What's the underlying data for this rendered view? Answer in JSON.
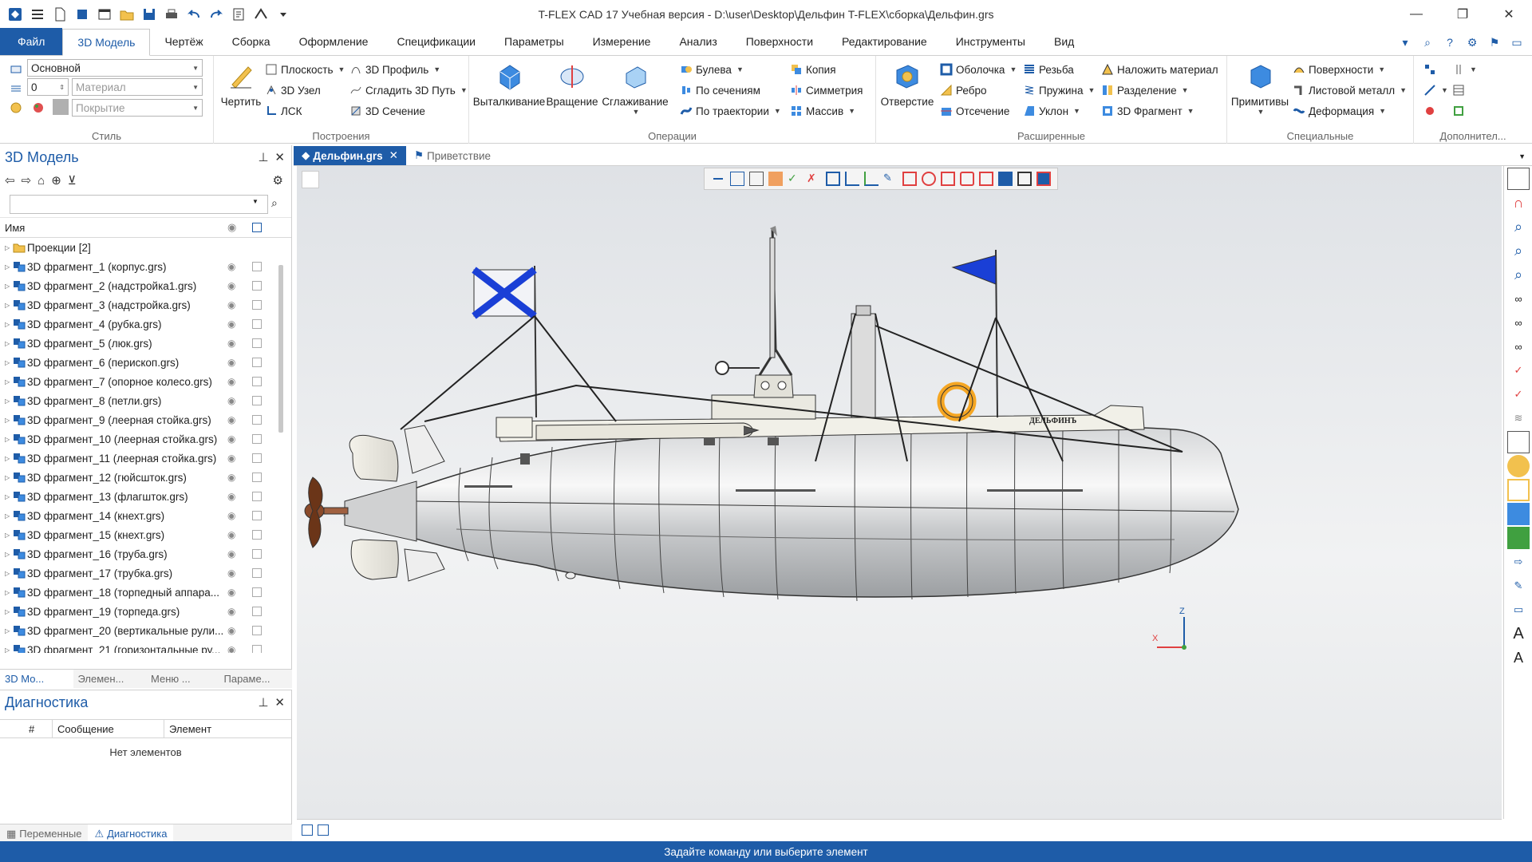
{
  "app": {
    "title": "T-FLEX CAD 17 Учебная версия - D:\\user\\Desktop\\Дельфин T-FLEX\\сборка\\Дельфин.grs"
  },
  "ribbon_tabs": [
    "Файл",
    "3D Модель",
    "Чертёж",
    "Сборка",
    "Оформление",
    "Спецификации",
    "Параметры",
    "Измерение",
    "Анализ",
    "Поверхности",
    "Редактирование",
    "Инструменты",
    "Вид"
  ],
  "active_tab": "3D Модель",
  "style_group": {
    "label": "Стиль",
    "layer": "Основной",
    "level": "0",
    "material_placeholder": "Материал",
    "coating_placeholder": "Покрытие"
  },
  "build_group": {
    "label": "Построения",
    "draw": "Чертить",
    "plane": "Плоскость",
    "node3d": "3D Узел",
    "lsk": "ЛСК",
    "profile3d": "3D Профиль",
    "smooth_path": "Сгладить 3D Путь",
    "section3d": "3D Сечение"
  },
  "ops_group": {
    "label": "Операции",
    "extrude": "Выталкивание",
    "rotate": "Вращение",
    "loft": "Сглаживание",
    "boolean": "Булева",
    "by_sections": "По сечениям",
    "by_path": "По траектории",
    "copy": "Копия",
    "symmetry": "Симметрия",
    "array": "Массив"
  },
  "ext_group": {
    "label": "Расширенные",
    "hole": "Отверстие",
    "shell": "Оболочка",
    "rib": "Ребро",
    "cut": "Отсечение",
    "thread": "Резьба",
    "spring": "Пружина",
    "slope": "Уклон",
    "apply_material": "Наложить материал",
    "split": "Разделение",
    "fragment3d": "3D Фрагмент"
  },
  "special_group": {
    "label": "Специальные",
    "primitives": "Примитивы",
    "surfaces": "Поверхности",
    "sheet_metal": "Листовой металл",
    "deform": "Деформация"
  },
  "extra_group": {
    "label": "Дополнител..."
  },
  "model_panel": {
    "title": "3D Модель",
    "col_name": "Имя",
    "items": [
      "Проекции [2]",
      "3D фрагмент_1 (корпус.grs)",
      "3D фрагмент_2 (надстройка1.grs)",
      "3D фрагмент_3 (надстройка.grs)",
      "3D фрагмент_4 (рубка.grs)",
      "3D фрагмент_5 (люк.grs)",
      "3D фрагмент_6 (перископ.grs)",
      "3D фрагмент_7 (опорное колесо.grs)",
      "3D фрагмент_8 (петли.grs)",
      "3D фрагмент_9 (леерная стойка.grs)",
      "3D фрагмент_10 (леерная стойка.grs)",
      "3D фрагмент_11 (леерная стойка.grs)",
      "3D фрагмент_12 (гюйсшток.grs)",
      "3D фрагмент_13 (флагшток.grs)",
      "3D фрагмент_14 (кнехт.grs)",
      "3D фрагмент_15 (кнехт.grs)",
      "3D фрагмент_16 (труба.grs)",
      "3D фрагмент_17 (трубка.grs)",
      "3D фрагмент_18 (торпедный аппара...",
      "3D фрагмент_19 (торпеда.grs)",
      "3D фрагмент_20 (вертикальные рули...",
      "3D фрагмент_21 (горизонтальные ру..."
    ],
    "bottom_tabs": [
      "3D Мо...",
      "Элемен...",
      "Меню ...",
      "Параме..."
    ]
  },
  "diagnostics": {
    "title": "Диагностика",
    "col_num": "#",
    "col_msg": "Сообщение",
    "col_elem": "Элемент",
    "empty": "Нет элементов",
    "tabs": [
      "Переменные",
      "Диагностика"
    ]
  },
  "doc_tabs": [
    "Дельфин.grs",
    "Приветствие"
  ],
  "hull_label": "ДЕЛЬФИНЪ",
  "status": "Задайте команду или выберите элемент",
  "colors": {
    "accent": "#1e5ca8",
    "flag_blue": "#1a3fd6",
    "buoy": "#f5a623"
  }
}
